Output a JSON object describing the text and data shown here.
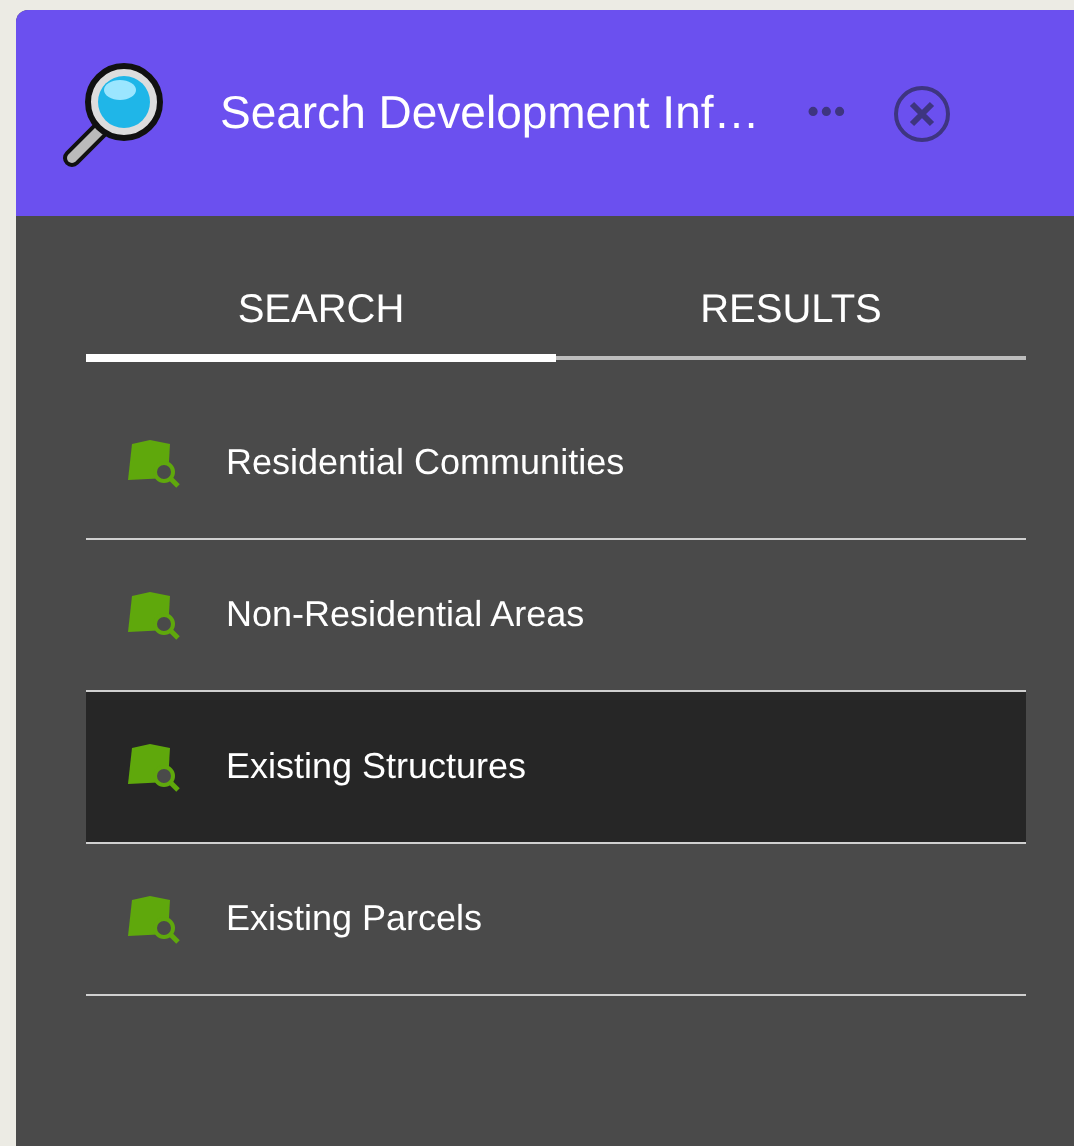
{
  "window": {
    "title": "Search Development Inf…",
    "menu_icon": "•••"
  },
  "tabs": [
    {
      "label": "SEARCH",
      "selected": true
    },
    {
      "label": "RESULTS",
      "selected": false
    }
  ],
  "items": [
    {
      "label": "Residential Communities",
      "selected": false
    },
    {
      "label": "Non-Residential Areas",
      "selected": false
    },
    {
      "label": "Existing Structures",
      "selected": true
    },
    {
      "label": "Existing Parcels",
      "selected": false
    }
  ]
}
